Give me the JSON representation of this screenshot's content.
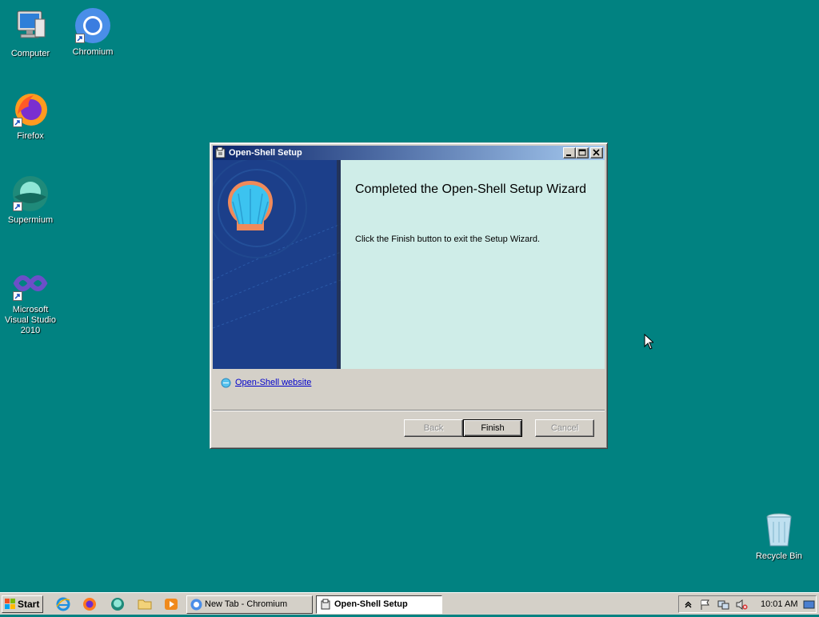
{
  "desktop": {
    "icons": [
      {
        "label": "Computer",
        "icon": "computer-icon"
      },
      {
        "label": "Chromium",
        "icon": "chromium-icon"
      },
      {
        "label": "Firefox",
        "icon": "firefox-icon"
      },
      {
        "label": "Supermium",
        "icon": "supermium-icon"
      },
      {
        "label": "Microsoft Visual Studio 2010",
        "icon": "visual-studio-icon"
      },
      {
        "label": "Recycle Bin",
        "icon": "recycle-bin-icon"
      }
    ]
  },
  "dialog": {
    "title": "Open-Shell Setup",
    "heading": "Completed the Open-Shell Setup Wizard",
    "description": "Click the Finish button to exit the Setup Wizard.",
    "link": "Open-Shell website",
    "buttons": {
      "back": "Back",
      "finish": "Finish",
      "cancel": "Cancel"
    }
  },
  "taskbar": {
    "start_label": "Start",
    "quick_launch": [
      "internet-explorer-icon",
      "firefox-icon",
      "supermium-icon",
      "folder-icon",
      "media-player-icon"
    ],
    "tasks": [
      {
        "label": "New Tab - Chromium",
        "active": false
      },
      {
        "label": "Open-Shell Setup",
        "active": true
      }
    ],
    "clock": "10:01 AM"
  },
  "colors": {
    "desktop": "#018281",
    "title_gradient_start": "#0a246a",
    "title_gradient_end": "#a6caf0",
    "wizard_content_bg": "#cfede8",
    "banner_bg": "#1c3f8a"
  }
}
